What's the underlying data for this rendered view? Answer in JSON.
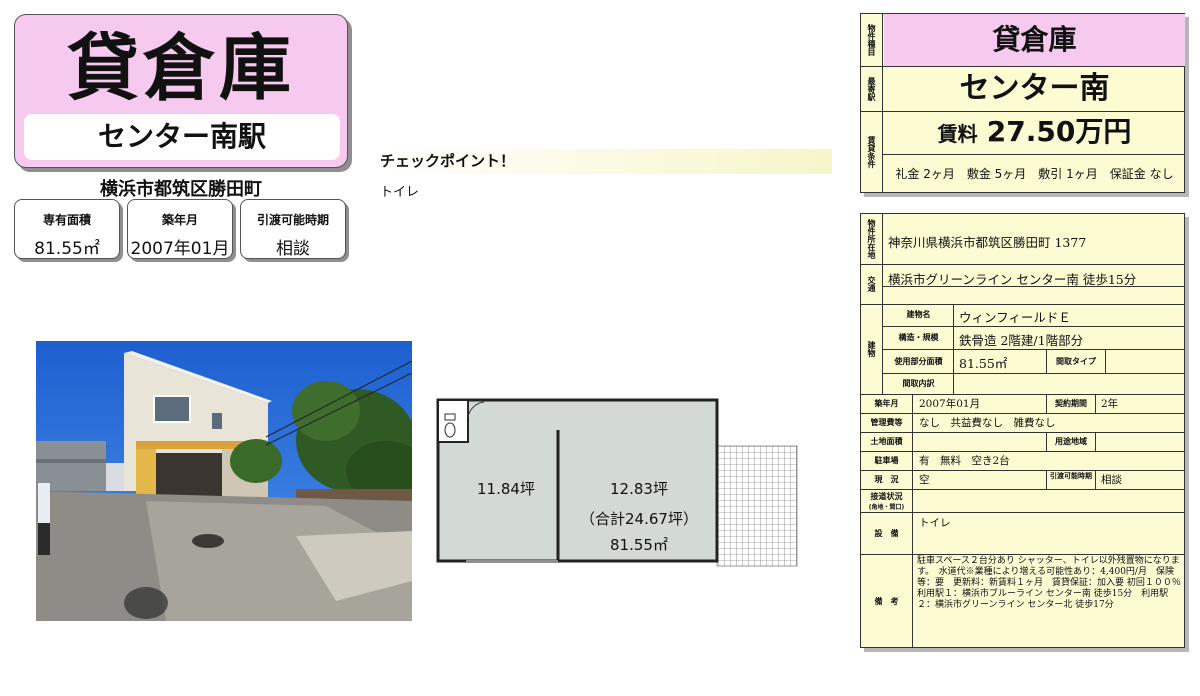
{
  "title_card": {
    "type": "貸倉庫",
    "station": "センター南駅"
  },
  "address_line": "横浜市都筑区勝田町",
  "specs": [
    {
      "label": "専有面積",
      "value": "81.55㎡"
    },
    {
      "label": "築年月",
      "value": "2007年01月"
    },
    {
      "label": "引渡可能時期",
      "value": "相談"
    }
  ],
  "checkpoint": {
    "title": "チェックポイント！",
    "body": "トイレ"
  },
  "floorplan": {
    "room1": "11.84坪",
    "room2": "12.83坪",
    "total": "（合計24.67坪）",
    "area": "81.55㎡"
  },
  "summary": {
    "type_label": "物件種目",
    "type": "貸倉庫",
    "station_label": "最寄駅",
    "station": "センター南",
    "rent_label": "賃貸条件",
    "rent_prefix": "賃料",
    "rent_value": "27.50万円",
    "conditions": "礼金 2ヶ月　敷金 5ヶ月　敷引 1ヶ月　保証金 なし"
  },
  "details": {
    "location_label": "物件所在地",
    "location": "神奈川県横浜市都筑区勝田町 1377",
    "transport_label": "交通",
    "transport": "横浜市グリーンライン センター南 徒歩15分",
    "building_label": "建物",
    "building_name_label": "建物名",
    "building_name": "ウィンフィールドＥ",
    "structure_label": "構造・規模",
    "structure": "鉄骨造 2階建/1階部分",
    "area_label": "使用部分面積",
    "area": "81.55㎡",
    "layout_type_label": "間取タイプ",
    "layout_type": "",
    "layout_detail_label": "間取内訳",
    "layout_detail": "",
    "built_label": "築年月",
    "built": "2007年01月",
    "contract_label": "契約期間",
    "contract": "2年",
    "mgmt_label": "管理費等",
    "mgmt": "なし　共益費なし　雑費なし",
    "land_label": "土地面積",
    "land": "",
    "zoning_label": "用途地域",
    "zoning": "",
    "parking_label": "駐車場",
    "parking": "有　無料　空き2台",
    "status_label": "現　況",
    "status": "空",
    "handover_label": "引渡可能時期",
    "handover": "相談",
    "road_label": "接道状況",
    "road_sub": "(角地・間口)",
    "road": "",
    "equipment_label": "設　備",
    "equipment": "トイレ",
    "remarks_label": "備　考",
    "remarks": "駐車スペース２台分あり シャッター、トイレ以外残置物になります。　水道代※業種により増える可能性あり：4,400円/月　保険等：要　更新料：新賃料１ヶ月　賃貸保証：加入要 初回１００％　利用駅１：横浜市ブルーライン センター南 徒歩15分　利用駅２：横浜市グリーンライン センター北 徒歩17分"
  },
  "colors": {
    "pink": "#f6c9ee",
    "cream": "#fdfbd2",
    "plan_fill": "#d3d9d4"
  }
}
